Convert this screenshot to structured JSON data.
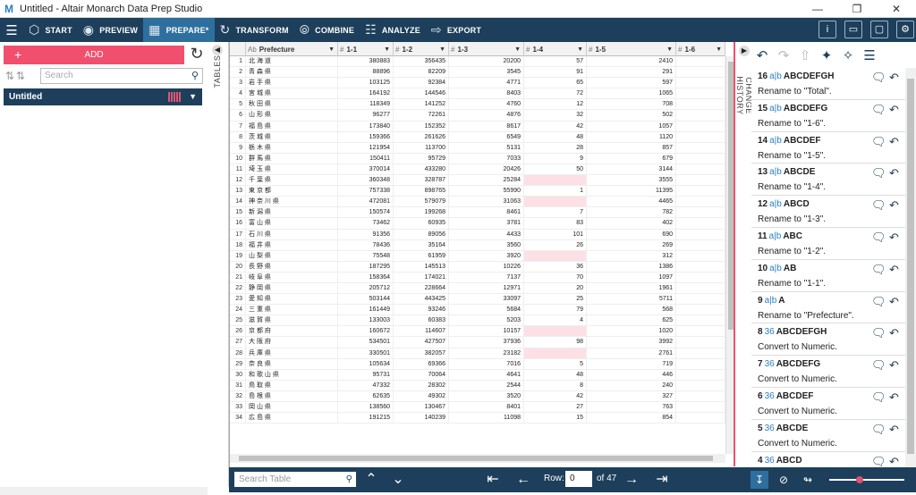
{
  "window": {
    "title": "Untitled - Altair Monarch Data Prep Studio",
    "app_icon": "M"
  },
  "toolbar": {
    "items": [
      {
        "label": "START",
        "icon": "cube-icon"
      },
      {
        "label": "PREVIEW",
        "icon": "eye-icon"
      },
      {
        "label": "PREPARE*",
        "icon": "table-icon"
      },
      {
        "label": "TRANSFORM",
        "icon": "cycle-icon"
      },
      {
        "label": "COMBINE",
        "icon": "venn-icon"
      },
      {
        "label": "ANALYZE",
        "icon": "clipboard-icon"
      },
      {
        "label": "EXPORT",
        "icon": "export-icon"
      }
    ],
    "active_index": 2,
    "right_icons": [
      "info-icon",
      "tablet-icon",
      "monitor-icon",
      "settings-icon"
    ]
  },
  "left": {
    "add_label": "ADD",
    "search_placeholder": "Search",
    "table_name": "Untitled",
    "tables_label": "TABLES"
  },
  "grid": {
    "columns": [
      {
        "type": "Ab",
        "name": "Prefecture"
      },
      {
        "type": "#",
        "name": "1-1"
      },
      {
        "type": "#",
        "name": "1-2"
      },
      {
        "type": "#",
        "name": "1-3"
      },
      {
        "type": "#",
        "name": "1-4"
      },
      {
        "type": "#",
        "name": "1-5"
      },
      {
        "type": "#",
        "name": "1-6"
      }
    ],
    "rows": [
      [
        "1",
        "北 海 道",
        "380883",
        "356435",
        "20200",
        "57",
        "2410"
      ],
      [
        "2",
        "青 森 県",
        "88896",
        "82209",
        "3545",
        "91",
        "291"
      ],
      [
        "3",
        "岩 手 県",
        "103125",
        "92384",
        "4771",
        "65",
        "597"
      ],
      [
        "4",
        "宮 城 県",
        "164192",
        "144546",
        "8403",
        "72",
        "1065"
      ],
      [
        "5",
        "秋 田 県",
        "118349",
        "141252",
        "4760",
        "12",
        "708"
      ],
      [
        "6",
        "山 形 県",
        "96277",
        "72261",
        "4876",
        "32",
        "502"
      ],
      [
        "7",
        "福 島 県",
        "173840",
        "152352",
        "8617",
        "42",
        "1057"
      ],
      [
        "8",
        "茨 城 県",
        "159366",
        "261626",
        "6549",
        "48",
        "1120"
      ],
      [
        "9",
        "栃 木 県",
        "121954",
        "113700",
        "5131",
        "28",
        "857"
      ],
      [
        "10",
        "群 馬 県",
        "150411",
        "95729",
        "7033",
        "9",
        "679"
      ],
      [
        "11",
        "埼 玉 県",
        "370014",
        "433280",
        "20426",
        "50",
        "3144"
      ],
      [
        "12",
        "千 葉 県",
        "360348",
        "328787",
        "25284",
        "",
        "3555"
      ],
      [
        "13",
        "東 京 都",
        "757338",
        "898765",
        "55990",
        "1",
        "11395"
      ],
      [
        "14",
        "神 奈 川 県",
        "472081",
        "579079",
        "31063",
        "",
        "4465"
      ],
      [
        "15",
        "新 潟 県",
        "150574",
        "199268",
        "8461",
        "7",
        "782"
      ],
      [
        "16",
        "富 山 県",
        "73462",
        "60935",
        "3781",
        "83",
        "402"
      ],
      [
        "17",
        "石 川 県",
        "91356",
        "89056",
        "4433",
        "101",
        "690"
      ],
      [
        "18",
        "福 井 県",
        "78436",
        "35164",
        "3560",
        "26",
        "269"
      ],
      [
        "19",
        "山 梨 県",
        "75548",
        "61959",
        "3920",
        "",
        "312"
      ],
      [
        "20",
        "長 野 県",
        "187295",
        "145513",
        "10226",
        "36",
        "1386"
      ],
      [
        "21",
        "岐 阜 県",
        "158364",
        "174021",
        "7137",
        "70",
        "1097"
      ],
      [
        "22",
        "静 岡 県",
        "205712",
        "228664",
        "12971",
        "20",
        "1961"
      ],
      [
        "23",
        "愛 知 県",
        "503144",
        "443425",
        "33097",
        "25",
        "5711"
      ],
      [
        "24",
        "三 重 県",
        "161449",
        "93246",
        "5684",
        "79",
        "568"
      ],
      [
        "25",
        "滋 賀 県",
        "133003",
        "60383",
        "5203",
        "4",
        "625"
      ],
      [
        "26",
        "京 都 府",
        "160672",
        "114607",
        "10157",
        "",
        "1020"
      ],
      [
        "27",
        "大 阪 府",
        "534501",
        "427507",
        "37936",
        "98",
        "3992"
      ],
      [
        "28",
        "兵 庫 県",
        "330501",
        "382057",
        "23182",
        "",
        "2761"
      ],
      [
        "29",
        "奈 良 県",
        "105634",
        "69366",
        "7016",
        "5",
        "719"
      ],
      [
        "30",
        "和 歌 山 県",
        "95731",
        "70064",
        "4641",
        "48",
        "446"
      ],
      [
        "31",
        "鳥 取 県",
        "47332",
        "28302",
        "2544",
        "8",
        "240"
      ],
      [
        "32",
        "島 根 県",
        "62635",
        "49302",
        "3520",
        "42",
        "327"
      ],
      [
        "33",
        "岡 山 県",
        "138560",
        "130467",
        "8401",
        "27",
        "763"
      ],
      [
        "34",
        "広 島 県",
        "191215",
        "140239",
        "11098",
        "15",
        "854"
      ]
    ]
  },
  "bottom": {
    "search_placeholder": "Search Table",
    "row_label": "Row:",
    "row_value": "0",
    "of_label": "of 47"
  },
  "history": {
    "label": "CHANGE HISTORY",
    "items": [
      {
        "num": "16",
        "type": "a|b",
        "col": "ABCDEFGH",
        "desc": "Rename to \"Total\"."
      },
      {
        "num": "15",
        "type": "a|b",
        "col": "ABCDEFG",
        "desc": "Rename to \"1-6\"."
      },
      {
        "num": "14",
        "type": "a|b",
        "col": "ABCDEF",
        "desc": "Rename to \"1-5\"."
      },
      {
        "num": "13",
        "type": "a|b",
        "col": "ABCDE",
        "desc": "Rename to \"1-4\"."
      },
      {
        "num": "12",
        "type": "a|b",
        "col": "ABCD",
        "desc": "Rename to \"1-3\"."
      },
      {
        "num": "11",
        "type": "a|b",
        "col": "ABC",
        "desc": "Rename to \"1-2\"."
      },
      {
        "num": "10",
        "type": "a|b",
        "col": "AB",
        "desc": "Rename to \"1-1\"."
      },
      {
        "num": "9",
        "type": "a|b",
        "col": "A",
        "desc": "Rename to \"Prefecture\"."
      },
      {
        "num": "8",
        "type": "36",
        "col": "ABCDEFGH",
        "desc": "Convert to Numeric."
      },
      {
        "num": "7",
        "type": "36",
        "col": "ABCDEFG",
        "desc": "Convert to Numeric."
      },
      {
        "num": "6",
        "type": "36",
        "col": "ABCDEF",
        "desc": "Convert to Numeric."
      },
      {
        "num": "5",
        "type": "36",
        "col": "ABCDE",
        "desc": "Convert to Numeric."
      },
      {
        "num": "4",
        "type": "36",
        "col": "ABCD",
        "desc": ""
      }
    ]
  },
  "colors": {
    "toolbar": "#1d3f5b",
    "accent": "#f0506e",
    "active": "#2e6f9e",
    "null_cell": "#fde0e5"
  }
}
